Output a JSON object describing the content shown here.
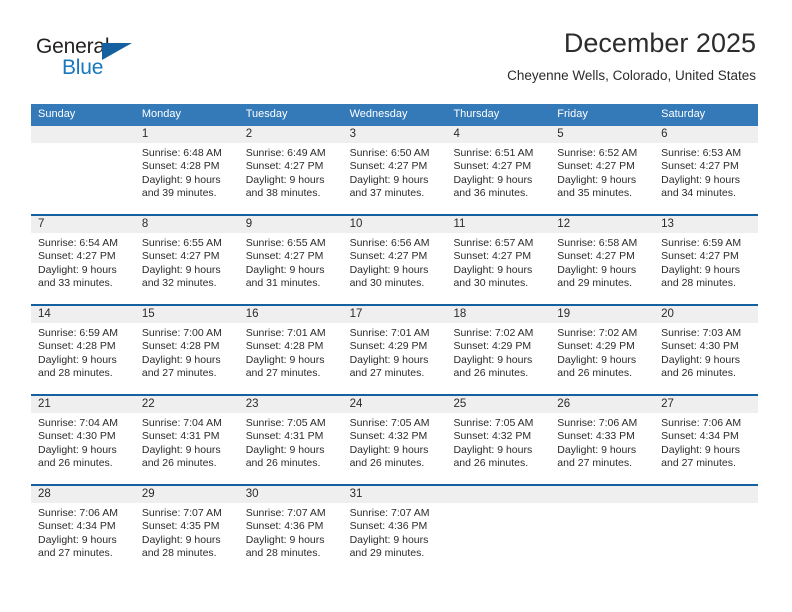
{
  "brand": {
    "word_one": "General",
    "word_two": "Blue",
    "triangle_color": "#15609f",
    "blue_text_color": "#1878be"
  },
  "header": {
    "title": "December 2025",
    "subtitle": "Cheyenne Wells, Colorado, United States"
  },
  "theme": {
    "header_bg": "#3479b8",
    "week_divider": "#15609f",
    "daynum_band": "#efefef",
    "text": "#2b2b2b"
  },
  "weekday_headers": [
    "Sunday",
    "Monday",
    "Tuesday",
    "Wednesday",
    "Thursday",
    "Friday",
    "Saturday"
  ],
  "weeks": [
    [
      {
        "day": "",
        "lines": []
      },
      {
        "day": "1",
        "lines": [
          "Sunrise: 6:48 AM",
          "Sunset: 4:28 PM",
          "Daylight: 9 hours",
          "and 39 minutes."
        ]
      },
      {
        "day": "2",
        "lines": [
          "Sunrise: 6:49 AM",
          "Sunset: 4:27 PM",
          "Daylight: 9 hours",
          "and 38 minutes."
        ]
      },
      {
        "day": "3",
        "lines": [
          "Sunrise: 6:50 AM",
          "Sunset: 4:27 PM",
          "Daylight: 9 hours",
          "and 37 minutes."
        ]
      },
      {
        "day": "4",
        "lines": [
          "Sunrise: 6:51 AM",
          "Sunset: 4:27 PM",
          "Daylight: 9 hours",
          "and 36 minutes."
        ]
      },
      {
        "day": "5",
        "lines": [
          "Sunrise: 6:52 AM",
          "Sunset: 4:27 PM",
          "Daylight: 9 hours",
          "and 35 minutes."
        ]
      },
      {
        "day": "6",
        "lines": [
          "Sunrise: 6:53 AM",
          "Sunset: 4:27 PM",
          "Daylight: 9 hours",
          "and 34 minutes."
        ]
      }
    ],
    [
      {
        "day": "7",
        "lines": [
          "Sunrise: 6:54 AM",
          "Sunset: 4:27 PM",
          "Daylight: 9 hours",
          "and 33 minutes."
        ]
      },
      {
        "day": "8",
        "lines": [
          "Sunrise: 6:55 AM",
          "Sunset: 4:27 PM",
          "Daylight: 9 hours",
          "and 32 minutes."
        ]
      },
      {
        "day": "9",
        "lines": [
          "Sunrise: 6:55 AM",
          "Sunset: 4:27 PM",
          "Daylight: 9 hours",
          "and 31 minutes."
        ]
      },
      {
        "day": "10",
        "lines": [
          "Sunrise: 6:56 AM",
          "Sunset: 4:27 PM",
          "Daylight: 9 hours",
          "and 30 minutes."
        ]
      },
      {
        "day": "11",
        "lines": [
          "Sunrise: 6:57 AM",
          "Sunset: 4:27 PM",
          "Daylight: 9 hours",
          "and 30 minutes."
        ]
      },
      {
        "day": "12",
        "lines": [
          "Sunrise: 6:58 AM",
          "Sunset: 4:27 PM",
          "Daylight: 9 hours",
          "and 29 minutes."
        ]
      },
      {
        "day": "13",
        "lines": [
          "Sunrise: 6:59 AM",
          "Sunset: 4:27 PM",
          "Daylight: 9 hours",
          "and 28 minutes."
        ]
      }
    ],
    [
      {
        "day": "14",
        "lines": [
          "Sunrise: 6:59 AM",
          "Sunset: 4:28 PM",
          "Daylight: 9 hours",
          "and 28 minutes."
        ]
      },
      {
        "day": "15",
        "lines": [
          "Sunrise: 7:00 AM",
          "Sunset: 4:28 PM",
          "Daylight: 9 hours",
          "and 27 minutes."
        ]
      },
      {
        "day": "16",
        "lines": [
          "Sunrise: 7:01 AM",
          "Sunset: 4:28 PM",
          "Daylight: 9 hours",
          "and 27 minutes."
        ]
      },
      {
        "day": "17",
        "lines": [
          "Sunrise: 7:01 AM",
          "Sunset: 4:29 PM",
          "Daylight: 9 hours",
          "and 27 minutes."
        ]
      },
      {
        "day": "18",
        "lines": [
          "Sunrise: 7:02 AM",
          "Sunset: 4:29 PM",
          "Daylight: 9 hours",
          "and 26 minutes."
        ]
      },
      {
        "day": "19",
        "lines": [
          "Sunrise: 7:02 AM",
          "Sunset: 4:29 PM",
          "Daylight: 9 hours",
          "and 26 minutes."
        ]
      },
      {
        "day": "20",
        "lines": [
          "Sunrise: 7:03 AM",
          "Sunset: 4:30 PM",
          "Daylight: 9 hours",
          "and 26 minutes."
        ]
      }
    ],
    [
      {
        "day": "21",
        "lines": [
          "Sunrise: 7:04 AM",
          "Sunset: 4:30 PM",
          "Daylight: 9 hours",
          "and 26 minutes."
        ]
      },
      {
        "day": "22",
        "lines": [
          "Sunrise: 7:04 AM",
          "Sunset: 4:31 PM",
          "Daylight: 9 hours",
          "and 26 minutes."
        ]
      },
      {
        "day": "23",
        "lines": [
          "Sunrise: 7:05 AM",
          "Sunset: 4:31 PM",
          "Daylight: 9 hours",
          "and 26 minutes."
        ]
      },
      {
        "day": "24",
        "lines": [
          "Sunrise: 7:05 AM",
          "Sunset: 4:32 PM",
          "Daylight: 9 hours",
          "and 26 minutes."
        ]
      },
      {
        "day": "25",
        "lines": [
          "Sunrise: 7:05 AM",
          "Sunset: 4:32 PM",
          "Daylight: 9 hours",
          "and 26 minutes."
        ]
      },
      {
        "day": "26",
        "lines": [
          "Sunrise: 7:06 AM",
          "Sunset: 4:33 PM",
          "Daylight: 9 hours",
          "and 27 minutes."
        ]
      },
      {
        "day": "27",
        "lines": [
          "Sunrise: 7:06 AM",
          "Sunset: 4:34 PM",
          "Daylight: 9 hours",
          "and 27 minutes."
        ]
      }
    ],
    [
      {
        "day": "28",
        "lines": [
          "Sunrise: 7:06 AM",
          "Sunset: 4:34 PM",
          "Daylight: 9 hours",
          "and 27 minutes."
        ]
      },
      {
        "day": "29",
        "lines": [
          "Sunrise: 7:07 AM",
          "Sunset: 4:35 PM",
          "Daylight: 9 hours",
          "and 28 minutes."
        ]
      },
      {
        "day": "30",
        "lines": [
          "Sunrise: 7:07 AM",
          "Sunset: 4:36 PM",
          "Daylight: 9 hours",
          "and 28 minutes."
        ]
      },
      {
        "day": "31",
        "lines": [
          "Sunrise: 7:07 AM",
          "Sunset: 4:36 PM",
          "Daylight: 9 hours",
          "and 29 minutes."
        ]
      },
      {
        "day": "",
        "lines": []
      },
      {
        "day": "",
        "lines": []
      },
      {
        "day": "",
        "lines": []
      }
    ]
  ]
}
